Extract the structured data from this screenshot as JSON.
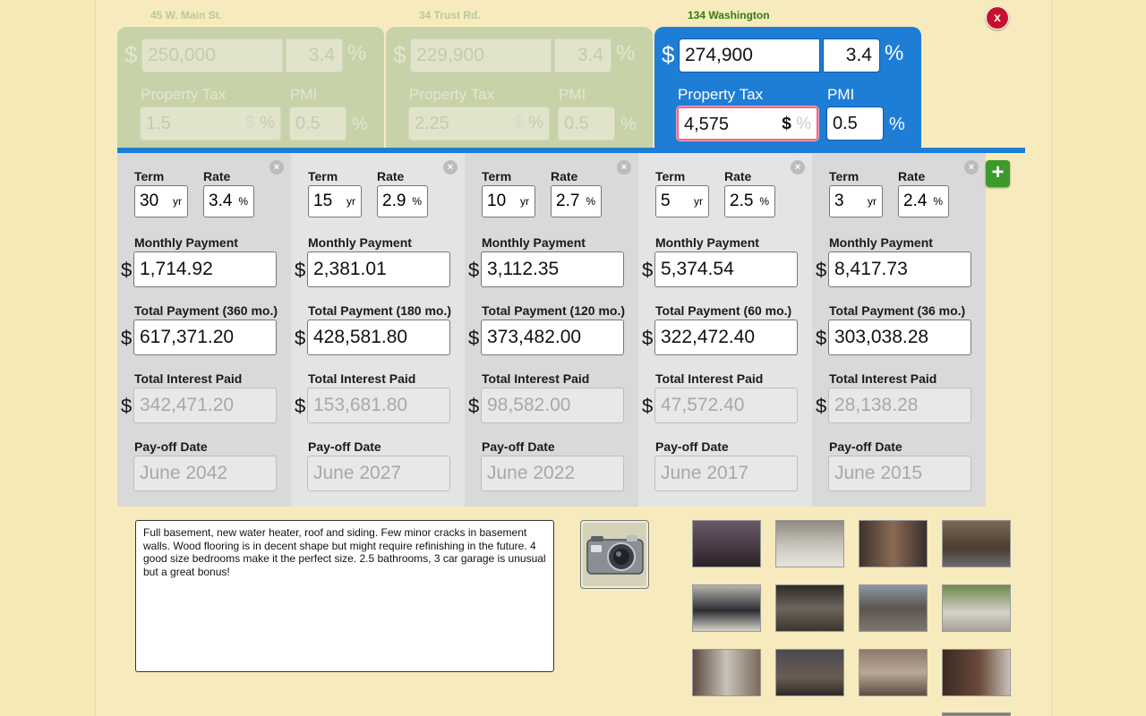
{
  "close_label": "x",
  "add_label": "+",
  "properties": [
    {
      "name": "45 W. Main St.",
      "price": "250,000",
      "rate": "3.4",
      "tax_label": "Property Tax",
      "tax": "1.5",
      "pmi_label": "PMI",
      "pmi": "0.5"
    },
    {
      "name": "34 Trust Rd.",
      "price": "229,900",
      "rate": "3.4",
      "tax_label": "Property Tax",
      "tax": "2.25",
      "pmi_label": "PMI",
      "pmi": "0.5"
    },
    {
      "name": "134 Washington",
      "price": "274,900",
      "rate": "3.4",
      "tax_label": "Property Tax",
      "tax": "4,575",
      "pmi_label": "PMI",
      "pmi": "0.5"
    }
  ],
  "symbols": {
    "dollar": "$",
    "percent": "%",
    "year": "yr",
    "close": "×"
  },
  "labels": {
    "term": "Term",
    "rate": "Rate",
    "monthly": "Monthly Payment",
    "interest": "Total Interest Paid",
    "payoff": "Pay-off Date"
  },
  "loans": [
    {
      "term": "30",
      "rate": "3.4",
      "monthly": "1,714.92",
      "total_label": "Total Payment (360 mo.)",
      "total": "617,371.20",
      "interest": "342,471.20",
      "payoff": "June 2042"
    },
    {
      "term": "15",
      "rate": "2.9",
      "monthly": "2,381.01",
      "total_label": "Total Payment (180 mo.)",
      "total": "428,581.80",
      "interest": "153,681.80",
      "payoff": "June 2027"
    },
    {
      "term": "10",
      "rate": "2.7",
      "monthly": "3,112.35",
      "total_label": "Total Payment (120 mo.)",
      "total": "373,482.00",
      "interest": "98,582.00",
      "payoff": "June 2022"
    },
    {
      "term": "5",
      "rate": "2.5",
      "monthly": "5,374.54",
      "total_label": "Total Payment (60 mo.)",
      "total": "322,472.40",
      "interest": "47,572.40",
      "payoff": "June 2017"
    },
    {
      "term": "3",
      "rate": "2.4",
      "monthly": "8,417.73",
      "total_label": "Total Payment (36 mo.)",
      "total": "303,038.28",
      "interest": "28,138.28",
      "payoff": "June 2015"
    }
  ],
  "notes": "Full basement, new water heater, roof and siding. Few minor cracks in basement walls. Wood flooring is in decent shape but might require refinishing in the future. 4 good size bedrooms make it the perfect size. 2.5 bathrooms, 3 car garage is unusual but a great bonus!",
  "colors": {
    "accent": "#1e7ed6",
    "background": "#f7ebbd",
    "inactive_card": "#c7d2a9",
    "close": "#c8102e",
    "add": "#3a9a2a"
  }
}
